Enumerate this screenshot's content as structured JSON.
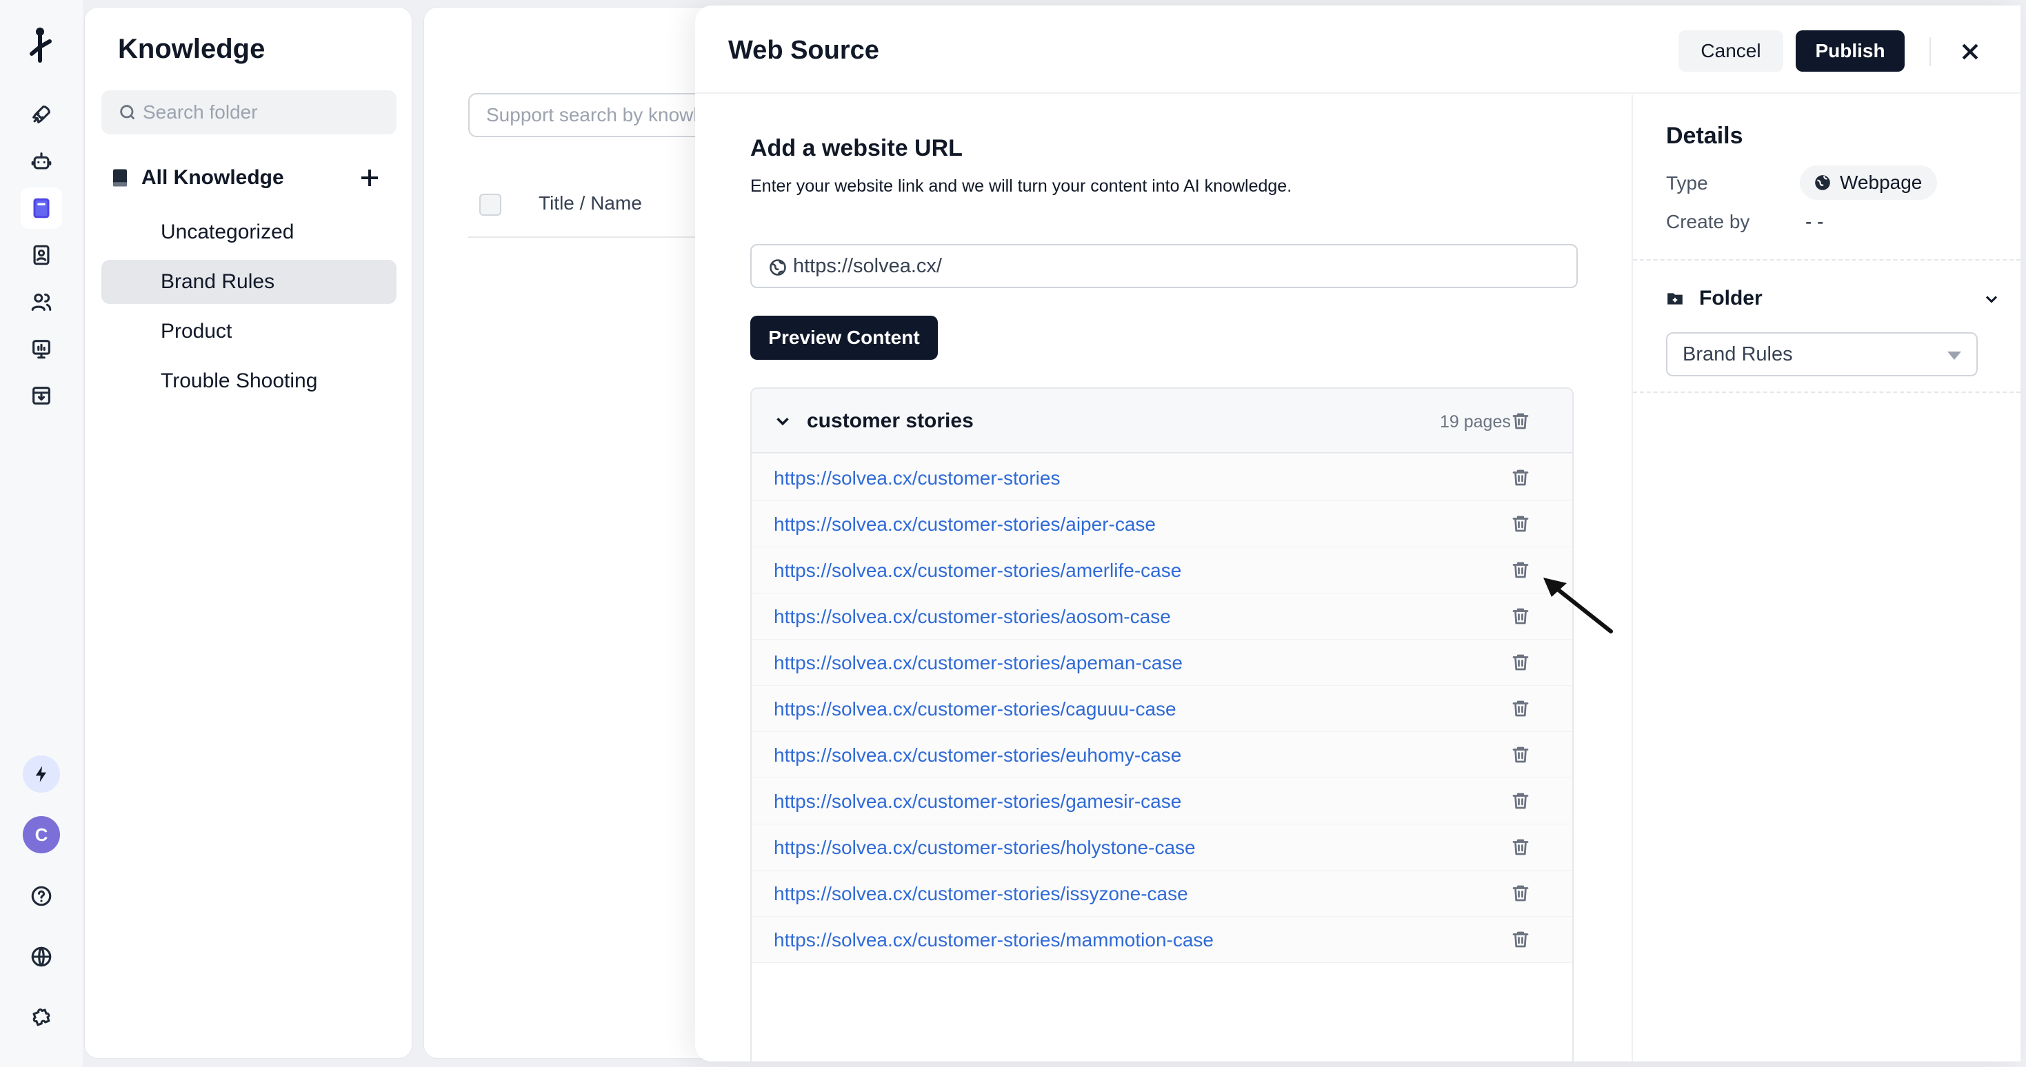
{
  "rail": {
    "items": [
      "rocket-icon",
      "bot-icon",
      "book-icon",
      "contacts-book-icon",
      "users-icon",
      "analytics-icon",
      "inbox-download-icon"
    ],
    "bottom": [
      "bolt-icon",
      "avatar",
      "help-icon",
      "globe-icon",
      "puzzle-icon"
    ],
    "avatar_initial": "C"
  },
  "folder_panel": {
    "title": "Knowledge",
    "search_placeholder": "Search folder",
    "all_label": "All Knowledge",
    "folders": [
      "Uncategorized",
      "Brand Rules",
      "Product",
      "Trouble Shooting"
    ],
    "selected": "Brand Rules"
  },
  "list_panel": {
    "search_placeholder": "Support search by knowledge title",
    "column_title": "Title / Name"
  },
  "drawer": {
    "title": "Web Source",
    "cancel": "Cancel",
    "publish": "Publish",
    "section_title": "Add a website URL",
    "section_desc": "Enter your website link and we will turn your content into AI knowledge.",
    "url_value": "https://solvea.cx/",
    "preview_button": "Preview Content",
    "group": {
      "name": "customer stories",
      "count": "19 pages",
      "urls": [
        "https://solvea.cx/customer-stories",
        "https://solvea.cx/customer-stories/aiper-case",
        "https://solvea.cx/customer-stories/amerlife-case",
        "https://solvea.cx/customer-stories/aosom-case",
        "https://solvea.cx/customer-stories/apeman-case",
        "https://solvea.cx/customer-stories/caguuu-case",
        "https://solvea.cx/customer-stories/euhomy-case",
        "https://solvea.cx/customer-stories/gamesir-case",
        "https://solvea.cx/customer-stories/holystone-case",
        "https://solvea.cx/customer-stories/issyzone-case",
        "https://solvea.cx/customer-stories/mammotion-case"
      ]
    }
  },
  "details": {
    "title": "Details",
    "type_label": "Type",
    "type_value": "Webpage",
    "create_label": "Create by",
    "create_value": "- -",
    "folder_title": "Folder",
    "folder_value": "Brand Rules"
  },
  "colors": {
    "accent": "#4f46e5",
    "primary_button": "#0f172a",
    "link": "#2f6ad6",
    "avatar": "#7c6fd8"
  }
}
